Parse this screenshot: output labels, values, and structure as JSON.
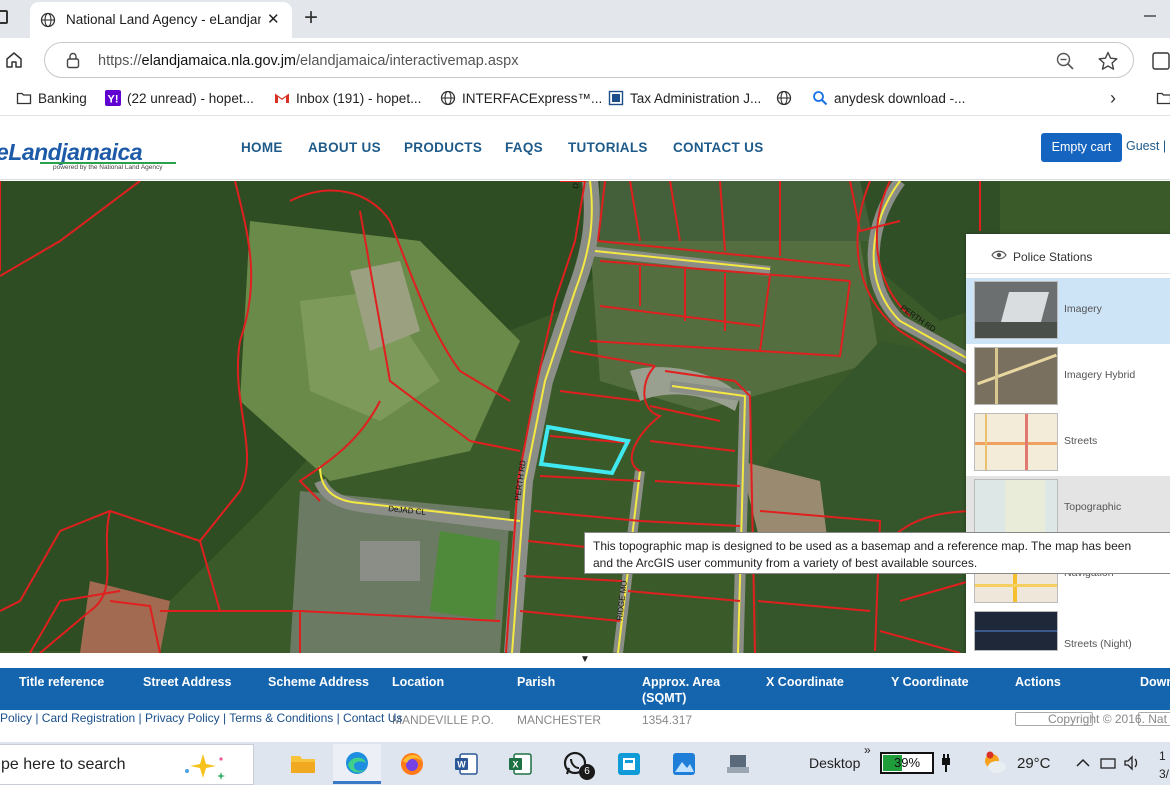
{
  "browser": {
    "tab_title": "National Land Agency - eLandjam",
    "tab_close": "✕",
    "new_tab": "+",
    "url_prefix": "https://",
    "url_host": "elandjamaica.nla.gov.jm",
    "url_path": "/elandjamaica/interactivemap.aspx",
    "bookmarks": [
      "Banking",
      "(22 unread) - hopet...",
      "Inbox (191) - hopet...",
      "INTERFACExpress™...",
      "Tax Administration J...",
      "",
      "anydesk download -..."
    ],
    "bookmarks_more": "›"
  },
  "site": {
    "logo": "eLandjamaica",
    "logo_sub": "powered by the National Land Agency",
    "nav": [
      "HOME",
      "ABOUT US",
      "PRODUCTS",
      "FAQS",
      "TUTORIALS",
      "CONTACT US"
    ],
    "cart_button": "Empty cart",
    "guest": "Guest | L"
  },
  "map": {
    "road_labels": [
      "PERTH RD",
      "DeJAD CL",
      "RIDGE MO",
      "PERTH RD",
      "D"
    ],
    "layers_header": "Police Stations",
    "basemaps": [
      {
        "label": "Imagery",
        "selected": true
      },
      {
        "label": "Imagery Hybrid",
        "selected": false
      },
      {
        "label": "Streets",
        "selected": false
      },
      {
        "label": "Topographic",
        "selected": false
      },
      {
        "label": "Navigation",
        "selected": false
      },
      {
        "label": "Streets (Night)",
        "selected": false
      }
    ],
    "tooltip_line1": "This topographic map is designed to be used as a basemap and a reference map.  The map has been",
    "tooltip_line2": "and the ArcGIS user community from a variety of best available sources.",
    "colors": {
      "parcel": "#e01f1f",
      "selected_parcel": "#40e8f0",
      "road": "#f4e842"
    }
  },
  "table": {
    "toggle": "▼",
    "headers": [
      "Title reference",
      "Street Address",
      "Scheme Address",
      "Location",
      "Parish",
      "Approx. Area\n(SQMT)",
      "X Coordinate",
      "Y Coordinate",
      "Actions",
      "Down"
    ],
    "row_partial": [
      "",
      "",
      "",
      "MANDEVILLE P.O.",
      "MANCHESTER",
      "1354.317"
    ],
    "footer_links": "Policy | Card Registration | Privacy Policy | Terms & Conditions | Contact Us",
    "copyright": "Copyright © 2016. Nat"
  },
  "taskbar": {
    "search_placeholder": "pe here to search",
    "desktop_label": "Desktop",
    "overflow": "»",
    "battery": "39%",
    "battery_level": 0.39,
    "temperature": "29°C",
    "clock_line1": "1",
    "clock_line2": "3/",
    "whatsapp_badge": "6"
  }
}
